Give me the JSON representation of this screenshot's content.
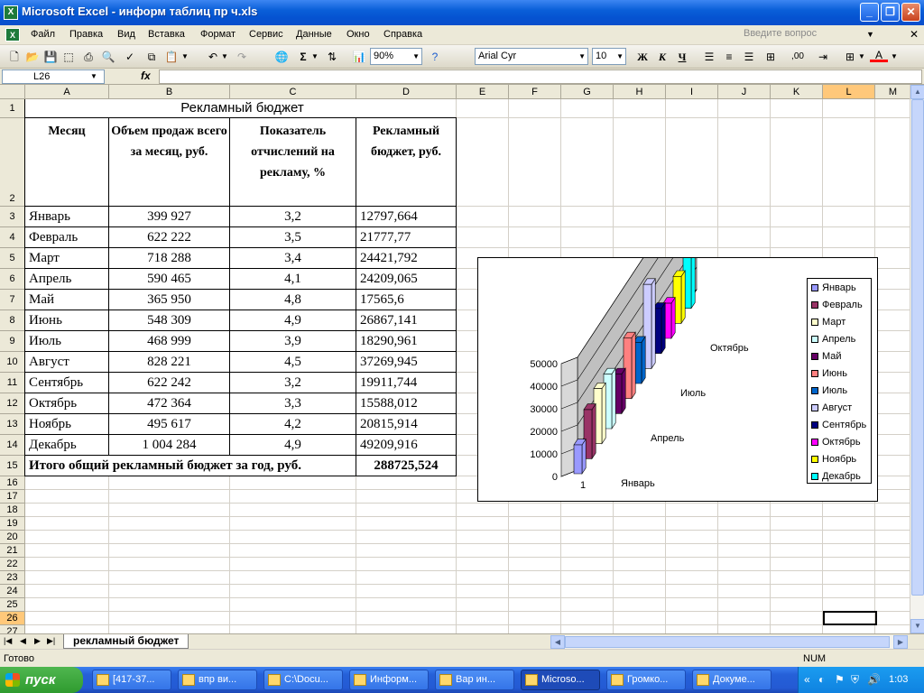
{
  "window": {
    "title": "Microsoft Excel - информ таблиц пр ч.xls",
    "app_icon": "X"
  },
  "menu": {
    "items": [
      "Файл",
      "Правка",
      "Вид",
      "Вставка",
      "Формат",
      "Сервис",
      "Данные",
      "Окно",
      "Справка"
    ],
    "help_placeholder": "Введите вопрос"
  },
  "toolbar": {
    "zoom": "90%",
    "font": "Arial Cyr",
    "size": "10",
    "bold": "Ж",
    "italic": "К",
    "underline": "Ч",
    "sigma": "Σ"
  },
  "formula": {
    "cell_ref": "L26",
    "fx": "fx",
    "value": ""
  },
  "columns": [
    "A",
    "B",
    "C",
    "D",
    "E",
    "F",
    "G",
    "H",
    "I",
    "J",
    "K",
    "L",
    "M"
  ],
  "rows": [
    "1",
    "2",
    "3",
    "4",
    "5",
    "6",
    "7",
    "8",
    "9",
    "10",
    "11",
    "12",
    "13",
    "14",
    "15",
    "16",
    "17",
    "18",
    "19",
    "20",
    "21",
    "22",
    "23",
    "24",
    "25",
    "26",
    "27"
  ],
  "table": {
    "title": "Рекламный бюджет",
    "headers": [
      "Месяц",
      "Объем продаж всего за месяц, руб.",
      "Показатель отчислений на рекламу, %",
      "Рекламный бюджет, руб."
    ],
    "data": [
      [
        "Январь",
        "399 927",
        "3,2",
        "12797,664"
      ],
      [
        "Февраль",
        "622 222",
        "3,5",
        "21777,77"
      ],
      [
        "Март",
        "718 288",
        "3,4",
        "24421,792"
      ],
      [
        "Апрель",
        "590 465",
        "4,1",
        "24209,065"
      ],
      [
        "Май",
        "365 950",
        "4,8",
        "17565,6"
      ],
      [
        "Июнь",
        "548 309",
        "4,9",
        "26867,141"
      ],
      [
        "Июль",
        "468 999",
        "3,9",
        "18290,961"
      ],
      [
        "Август",
        "828 221",
        "4,5",
        "37269,945"
      ],
      [
        "Сентябрь",
        "622 242",
        "3,2",
        "19911,744"
      ],
      [
        "Октябрь",
        "472 364",
        "3,3",
        "15588,012"
      ],
      [
        "Ноябрь",
        "495 617",
        "4,2",
        "20815,914"
      ],
      [
        "Декабрь",
        "1 004 284",
        "4,9",
        "49209,916"
      ]
    ],
    "total_label": "Итого общий рекламный бюджет за год, руб.",
    "total_value": "288725,524"
  },
  "chart_data": {
    "type": "bar",
    "categories": [
      "1"
    ],
    "series": [
      {
        "name": "Январь",
        "values": [
          12797.664
        ],
        "color": "#9999ff"
      },
      {
        "name": "Февраль",
        "values": [
          21777.77
        ],
        "color": "#993366"
      },
      {
        "name": "Март",
        "values": [
          24421.792
        ],
        "color": "#ffffcc"
      },
      {
        "name": "Апрель",
        "values": [
          24209.065
        ],
        "color": "#ccffff"
      },
      {
        "name": "Май",
        "values": [
          17565.6
        ],
        "color": "#660066"
      },
      {
        "name": "Июнь",
        "values": [
          26867.141
        ],
        "color": "#ff8080"
      },
      {
        "name": "Июль",
        "values": [
          18290.961
        ],
        "color": "#0066cc"
      },
      {
        "name": "Август",
        "values": [
          37269.945
        ],
        "color": "#ccccff"
      },
      {
        "name": "Сентябрь",
        "values": [
          19911.744
        ],
        "color": "#000080"
      },
      {
        "name": "Октябрь",
        "values": [
          15588.012
        ],
        "color": "#ff00ff"
      },
      {
        "name": "Ноябрь",
        "values": [
          20815.914
        ],
        "color": "#ffff00"
      },
      {
        "name": "Декабрь",
        "values": [
          49209.916
        ],
        "color": "#00ffff"
      }
    ],
    "depth_labels": [
      "Январь",
      "Апрель",
      "Июль",
      "Октябрь"
    ],
    "yticks": [
      "0",
      "10000",
      "20000",
      "30000",
      "40000",
      "50000"
    ],
    "ylim": [
      0,
      50000
    ],
    "legend_position": "right",
    "grid": true
  },
  "sheet_tab": "рекламный бюджет",
  "status": {
    "left": "Готово",
    "num": "NUM"
  },
  "taskbar": {
    "start": "пуск",
    "tasks": [
      "[417-37...",
      "впр ви...",
      "C:\\Docu...",
      "Информ...",
      "Вар ин...",
      "Microso...",
      "Громко...",
      "Докуме..."
    ],
    "clock": "1:03"
  }
}
